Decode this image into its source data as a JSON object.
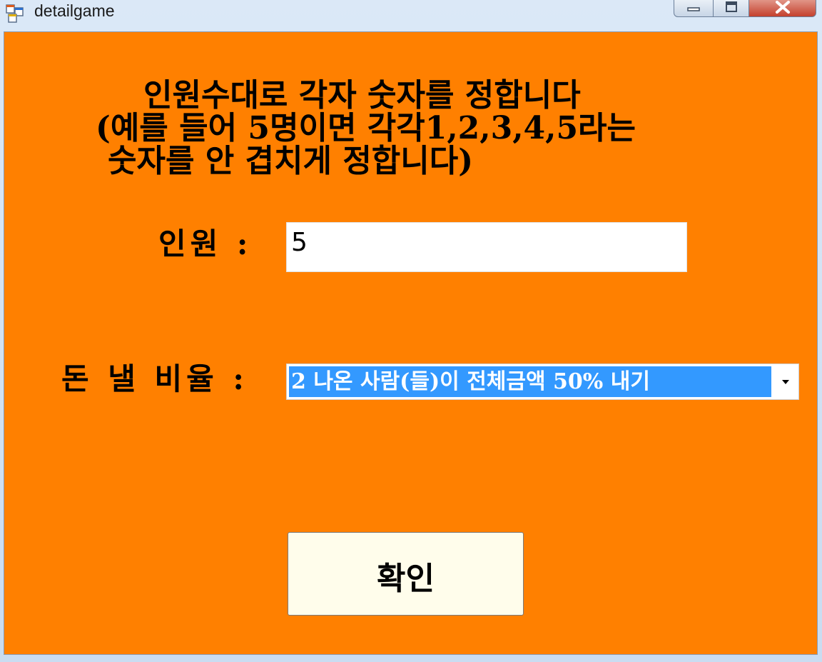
{
  "window": {
    "title": "detailgame",
    "icon": "windows-form-icon",
    "client_color": "#ff8000"
  },
  "description": {
    "line1": "인원수대로 각자 숫자를 정합니다",
    "line2": "(예를 들어 5명이면 각각1,2,3,4,5라는",
    "line3": "숫자를 안 겹치게 정합니다)"
  },
  "people": {
    "label": "인원 :",
    "value": "5"
  },
  "ratio": {
    "label": "돈 낼 비율 :",
    "selected": "2 나온 사람(들)이 전체금액 50% 내기",
    "selection_color": "#3399ff"
  },
  "confirm": {
    "label": "확인"
  }
}
